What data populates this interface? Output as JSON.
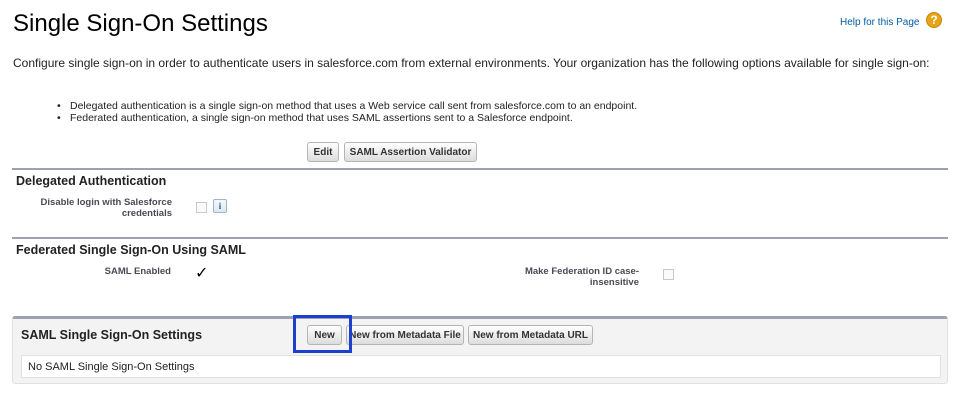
{
  "header": {
    "title": "Single Sign-On Settings",
    "help_link": "Help for this Page",
    "help_icon": "question-circle-icon",
    "help_icon_glyph": "?"
  },
  "intro": {
    "text": "Configure single sign-on in order to authenticate users in salesforce.com from external environments. Your organization has the following options available for single sign-on:",
    "bullets": [
      "Delegated authentication is a single sign-on method that uses a Web service call sent from salesforce.com to an endpoint.",
      "Federated authentication, a single sign-on method that uses SAML assertions sent to a Salesforce endpoint."
    ]
  },
  "toolbar": {
    "edit_label": "Edit",
    "saml_validator_label": "SAML Assertion Validator"
  },
  "delegated": {
    "title": "Delegated Authentication",
    "disable_login_label": "Disable login with Salesforce credentials",
    "disable_login_checked": false,
    "info_icon": "info-icon",
    "info_glyph": "i"
  },
  "federated": {
    "title": "Federated Single Sign-On Using SAML",
    "saml_enabled_label": "SAML Enabled",
    "saml_enabled_checked": true,
    "saml_enabled_glyph": "✓",
    "federation_case_label": "Make Federation ID case-insensitive",
    "federation_case_checked": false
  },
  "saml_settings": {
    "title": "SAML Single Sign-On Settings",
    "new_label": "New",
    "new_from_file_label": "New from Metadata File",
    "new_from_url_label": "New from Metadata URL",
    "empty_text": "No SAML Single Sign-On Settings"
  },
  "colors": {
    "link": "#015ba7",
    "section_rule": "#9c9fb6",
    "highlight": "#1d3fcf",
    "help_icon": "#e8a317"
  }
}
